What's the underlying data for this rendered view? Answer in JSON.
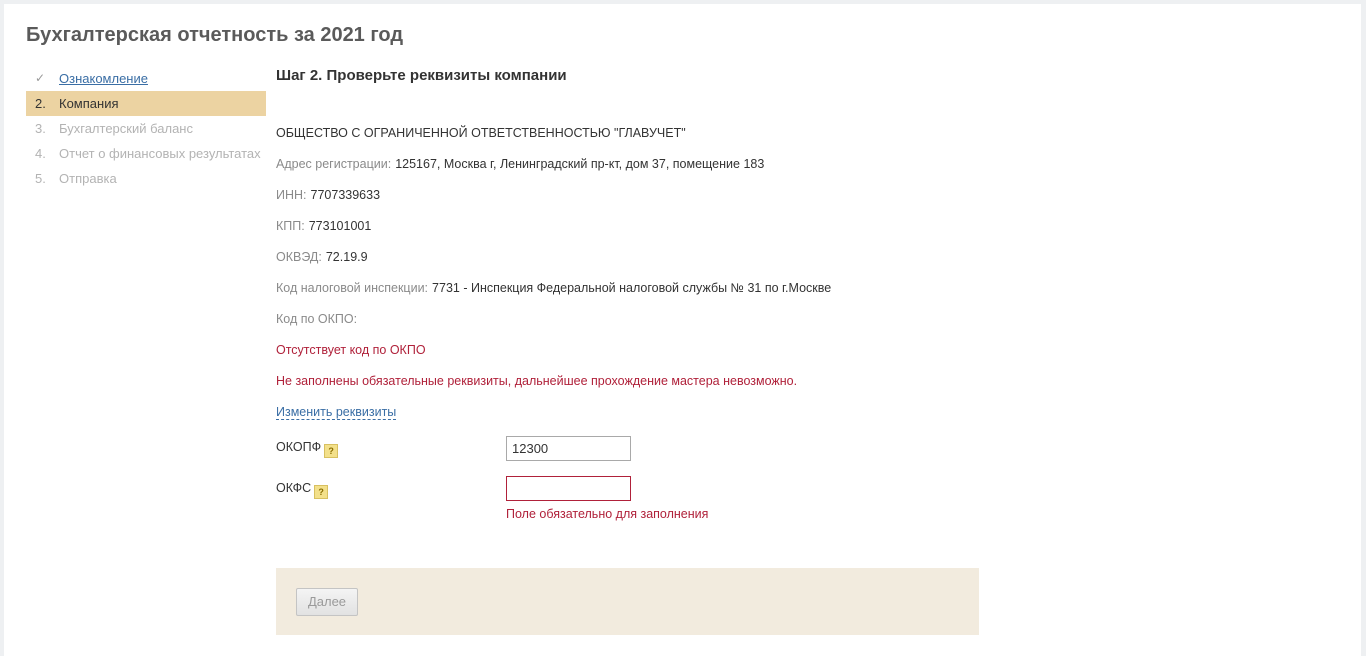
{
  "page_title": "Бухгалтерская отчетность за 2021 год",
  "steps": [
    {
      "num": "✓",
      "label": "Ознакомление",
      "state": "done"
    },
    {
      "num": "2.",
      "label": "Компания",
      "state": "active"
    },
    {
      "num": "3.",
      "label": "Бухгалтерский баланс",
      "state": "pending"
    },
    {
      "num": "4.",
      "label": "Отчет о финансовых результатах",
      "state": "pending"
    },
    {
      "num": "5.",
      "label": "Отправка",
      "state": "pending"
    }
  ],
  "step_heading": "Шаг 2. Проверьте реквизиты компании",
  "company": {
    "name": "ОБЩЕСТВО С ОГРАНИЧЕННОЙ ОТВЕТСТВЕННОСТЬЮ \"ГЛАВУЧЕТ\"",
    "address_label": "Адрес регистрации:",
    "address_value": "125167, Москва г, Ленинградский пр-кт, дом 37, помещение 183",
    "inn_label": "ИНН:",
    "inn_value": "7707339633",
    "kpp_label": "КПП:",
    "kpp_value": "773101001",
    "okved_label": "ОКВЭД:",
    "okved_value": "72.19.9",
    "tax_label": "Код налоговой инспекции:",
    "tax_value": "7731 - Инспекция Федеральной налоговой службы № 31 по г.Москве",
    "okpo_label": "Код по ОКПО:",
    "okpo_value": ""
  },
  "errors": {
    "okpo_missing": "Отсутствует код по ОКПО",
    "cannot_continue": "Не заполнены обязательные реквизиты, дальнейшее прохождение мастера невозможно."
  },
  "edit_link": "Изменить реквизиты",
  "form": {
    "okopf_label": "ОКОПФ",
    "okopf_value": "12300",
    "okfs_label": "ОКФС",
    "okfs_value": "",
    "okfs_error": "Поле обязательно для заполнения",
    "help_glyph": "?"
  },
  "next_button": "Далее",
  "colors": {
    "active_step": "#ecd3a2",
    "error": "#b0213a",
    "link": "#3a6ea5",
    "footer": "#f2ebde"
  }
}
